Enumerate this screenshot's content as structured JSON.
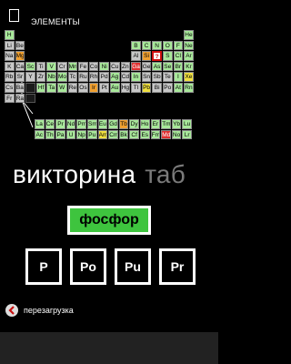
{
  "header": {
    "title": "ЭЛЕМЕНТЫ"
  },
  "periodic_table": {
    "colors": {
      "nonmetal": "#a8e89a",
      "highlight_orange": "#f0a030",
      "highlight_yellow": "#f0e040",
      "highlight_red": "#e03030",
      "gray": "#c8c8c8",
      "question_mark_border": "#d01010"
    },
    "main_rows": [
      [
        "H",
        "",
        "",
        "",
        "",
        "",
        "",
        "",
        "",
        "",
        "",
        "",
        "",
        "",
        "",
        "",
        "",
        "He"
      ],
      [
        "Li",
        "Be",
        "",
        "",
        "",
        "",
        "",
        "",
        "",
        "",
        "",
        "",
        "B",
        "C",
        "N",
        "O",
        "F",
        "Ne"
      ],
      [
        "Na",
        "Mg",
        "",
        "",
        "",
        "",
        "",
        "",
        "",
        "",
        "",
        "",
        "Al",
        "Si",
        "?",
        "S",
        "Cl",
        "Ar"
      ],
      [
        "K",
        "Ca",
        "Sc",
        "Ti",
        "V",
        "Cr",
        "Mn",
        "Fe",
        "Co",
        "Ni",
        "Cu",
        "Zn",
        "Ga",
        "Ge",
        "As",
        "Se",
        "Br",
        "Kr"
      ],
      [
        "Rb",
        "Sr",
        "Y",
        "Zr",
        "Nb",
        "Mo",
        "Tc",
        "Ru",
        "Rh",
        "Pd",
        "Ag",
        "Cd",
        "In",
        "Sn",
        "Sb",
        "Te",
        "I",
        "Xe"
      ],
      [
        "Cs",
        "Ba",
        "",
        "Hf",
        "Ta",
        "W",
        "Re",
        "Os",
        "Ir",
        "Pt",
        "Au",
        "Hg",
        "Tl",
        "Pb",
        "Bi",
        "Po",
        "At",
        "Rn"
      ],
      [
        "Fr",
        "Ra",
        "",
        "",
        "",
        "",
        "",
        "",
        "",
        "",
        "",
        "",
        "",
        "",
        "",
        "",
        "",
        ""
      ]
    ],
    "lanthanides": [
      "La",
      "Ce",
      "Pr",
      "Nd",
      "Pm",
      "Sm",
      "Eu",
      "Gd",
      "Tb",
      "Dy",
      "Ho",
      "Er",
      "Tm",
      "Yb",
      "Lu"
    ],
    "actinides": [
      "Ac",
      "Th",
      "Pa",
      "U",
      "Np",
      "Pu",
      "Am",
      "Cm",
      "Bk",
      "Cf",
      "Es",
      "Fm",
      "Md",
      "No",
      "Lr"
    ]
  },
  "quiz": {
    "title": "викторина",
    "next_title": "таб",
    "question": "фосфор",
    "choices": [
      "P",
      "Po",
      "Pu",
      "Pr"
    ]
  },
  "footer": {
    "restart_label": "перезагрузка"
  }
}
